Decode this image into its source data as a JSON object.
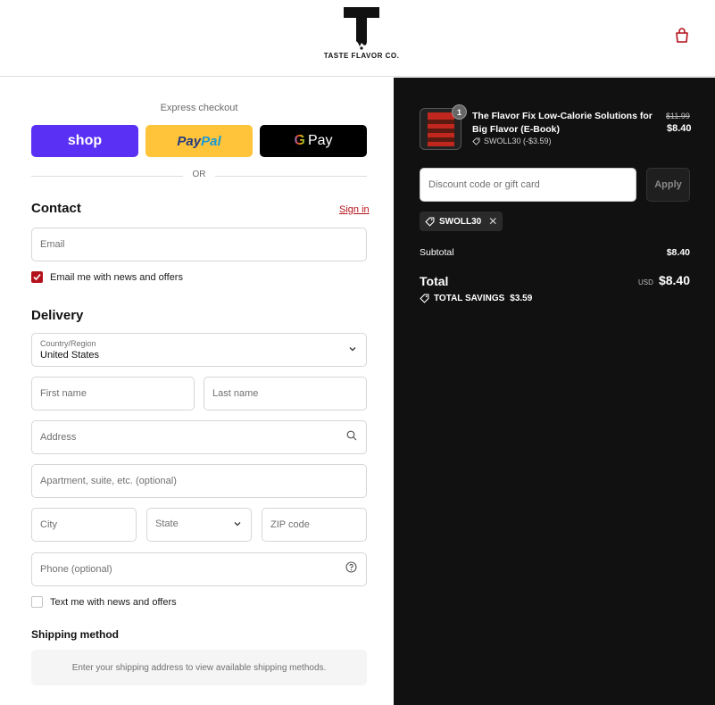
{
  "header": {
    "brand_name": "TASTE FLAVOR CO."
  },
  "express": {
    "title": "Express checkout",
    "shop_label": "shop",
    "paypal_label_1": "Pay",
    "paypal_label_2": "Pal",
    "gpay_g": "G",
    "gpay_label": "Pay",
    "or_label": "OR"
  },
  "contact": {
    "heading": "Contact",
    "signin_label": "Sign in",
    "email_placeholder": "Email",
    "news_label": "Email me with news and offers",
    "news_checked": true
  },
  "delivery": {
    "heading": "Delivery",
    "country_label": "Country/Region",
    "country_value": "United States",
    "first_name_placeholder": "First name",
    "last_name_placeholder": "Last name",
    "address_placeholder": "Address",
    "apartment_placeholder": "Apartment, suite, etc. (optional)",
    "city_placeholder": "City",
    "state_placeholder": "State",
    "zip_placeholder": "ZIP code",
    "phone_placeholder": "Phone (optional)",
    "text_label": "Text me with news and offers",
    "text_checked": false
  },
  "shipping": {
    "heading": "Shipping method",
    "message": "Enter your shipping address to view available shipping methods."
  },
  "order": {
    "quantity": "1",
    "product_title": "The Flavor Fix Low-Calorie Solutions for Big Flavor (E-Book)",
    "product_code": "SWOLL30 (-$3.59)",
    "original_price": "$11.99",
    "price": "$8.40",
    "discount_placeholder": "Discount code or gift card",
    "apply_label": "Apply",
    "applied_code": "SWOLL30",
    "subtotal_label": "Subtotal",
    "subtotal_value": "$8.40",
    "total_label": "Total",
    "currency": "USD",
    "total_value": "$8.40",
    "savings_label": "TOTAL SAVINGS",
    "savings_value": "$3.59"
  },
  "colors": {
    "accent": "#b4121b",
    "shop": "#5a31f4",
    "paypal": "#ffc439",
    "panel": "#111111"
  }
}
